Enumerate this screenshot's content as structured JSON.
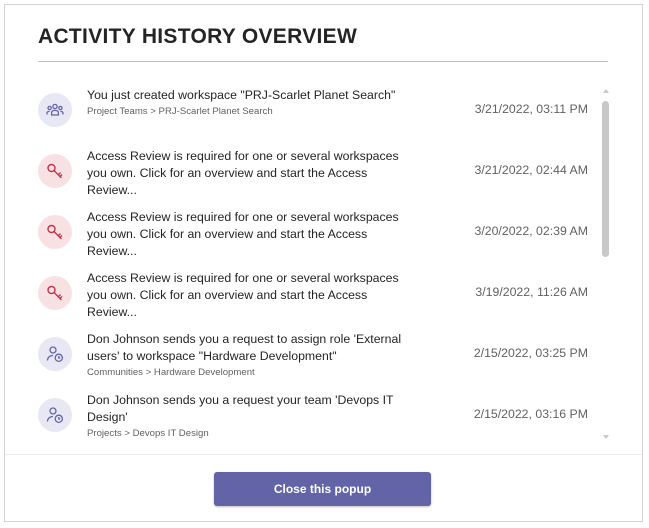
{
  "popup": {
    "title": "ACTIVITY HISTORY OVERVIEW",
    "close_label": "Close this popup"
  },
  "colors": {
    "accent": "#6264a7",
    "key_icon": "#c4314b",
    "key_icon_bg": "#f8e1e3",
    "team_icon_bg": "#e8e8f4"
  },
  "items": [
    {
      "icon": "team-icon",
      "text": "You just created workspace \"PRJ-Scarlet Planet Search\"",
      "crumb": "Project Teams > PRJ-Scarlet Planet Search",
      "date": "3/21/2022, 03:11 PM"
    },
    {
      "icon": "key-icon",
      "text": "Access Review is required for one or several workspaces you own. Click for an overview and start the Access Review...",
      "crumb": "",
      "date": "3/21/2022, 02:44 AM"
    },
    {
      "icon": "key-icon",
      "text": "Access Review is required for one or several workspaces you own. Click for an overview and start the Access Review...",
      "crumb": "",
      "date": "3/20/2022, 02:39 AM"
    },
    {
      "icon": "key-icon",
      "text": "Access Review is required for one or several workspaces you own. Click for an overview and start the Access Review...",
      "crumb": "",
      "date": "3/19/2022, 11:26 AM"
    },
    {
      "icon": "person-clock-icon",
      "text": "Don Johnson sends you a request to assign role 'External users' to workspace \"Hardware Development\"",
      "crumb": "Communities > Hardware Development",
      "date": "2/15/2022, 03:25 PM"
    },
    {
      "icon": "person-clock-icon",
      "text": "Don Johnson sends you a request your team 'Devops IT Design'",
      "crumb": "Projects > Devops IT Design",
      "date": "2/15/2022, 03:16 PM"
    }
  ]
}
